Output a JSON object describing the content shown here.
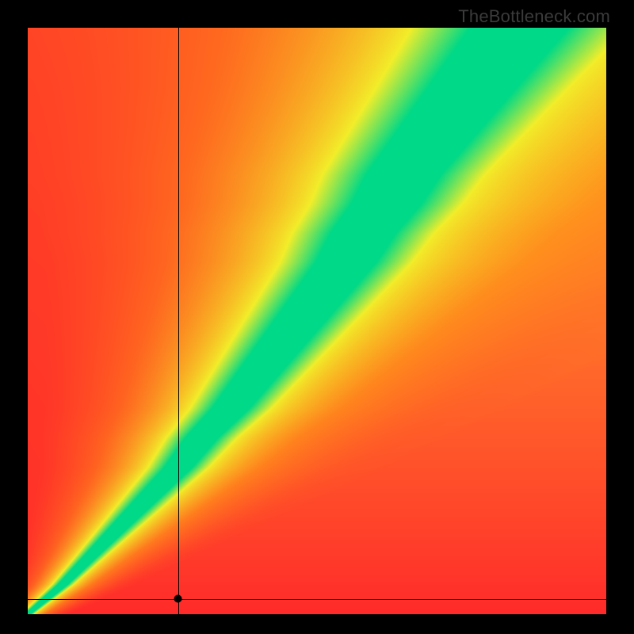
{
  "watermark": "TheBottleneck.com",
  "chart_data": {
    "type": "heatmap",
    "title": "",
    "xlabel": "",
    "ylabel": "",
    "xlim": [
      0,
      1
    ],
    "ylim": [
      0,
      1
    ],
    "grid": false,
    "crosshair": {
      "x": 0.26,
      "y": 0.025
    },
    "marker": {
      "x": 0.26,
      "y": 0.025
    },
    "ridge_curve": {
      "description": "center of green band: x as a function of y (normalized 0..1)",
      "points": [
        {
          "y": 0.0,
          "x": 0.0
        },
        {
          "y": 0.05,
          "x": 0.06
        },
        {
          "y": 0.1,
          "x": 0.11
        },
        {
          "y": 0.15,
          "x": 0.16
        },
        {
          "y": 0.2,
          "x": 0.21
        },
        {
          "y": 0.25,
          "x": 0.26
        },
        {
          "y": 0.3,
          "x": 0.3
        },
        {
          "y": 0.35,
          "x": 0.35
        },
        {
          "y": 0.4,
          "x": 0.39
        },
        {
          "y": 0.45,
          "x": 0.43
        },
        {
          "y": 0.5,
          "x": 0.47
        },
        {
          "y": 0.55,
          "x": 0.51
        },
        {
          "y": 0.6,
          "x": 0.55
        },
        {
          "y": 0.65,
          "x": 0.58
        },
        {
          "y": 0.7,
          "x": 0.62
        },
        {
          "y": 0.75,
          "x": 0.65
        },
        {
          "y": 0.8,
          "x": 0.69
        },
        {
          "y": 0.85,
          "x": 0.73
        },
        {
          "y": 0.9,
          "x": 0.77
        },
        {
          "y": 0.95,
          "x": 0.81
        },
        {
          "y": 1.0,
          "x": 0.85
        }
      ]
    },
    "band_half_width": {
      "description": "half-width of green band (normalized x units) as function of y",
      "points": [
        {
          "y": 0.0,
          "w": 0.005
        },
        {
          "y": 0.1,
          "w": 0.012
        },
        {
          "y": 0.2,
          "w": 0.02
        },
        {
          "y": 0.3,
          "w": 0.028
        },
        {
          "y": 0.4,
          "w": 0.036
        },
        {
          "y": 0.5,
          "w": 0.044
        },
        {
          "y": 0.6,
          "w": 0.052
        },
        {
          "y": 0.7,
          "w": 0.06
        },
        {
          "y": 0.8,
          "w": 0.068
        },
        {
          "y": 0.9,
          "w": 0.076
        },
        {
          "y": 1.0,
          "w": 0.085
        }
      ]
    },
    "falloff": {
      "description": "distance (in band-half-widths) for green->yellow->orange->red transitions",
      "green_edge": 1.0,
      "yellow_edge": 2.2,
      "orange_edge": 6.0
    },
    "right_side_floor": {
      "description": "right-of-band region floor color blends toward yellow/orange with height",
      "bottom_color": "#ff2a2a",
      "top_color": "#ffe02a"
    },
    "colors": {
      "green": "#00d987",
      "yellow": "#f2ee2a",
      "orange": "#ff8a1a",
      "red": "#ff2a2a"
    }
  }
}
